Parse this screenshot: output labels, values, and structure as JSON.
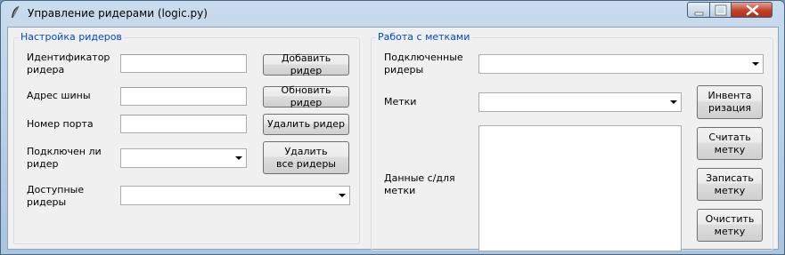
{
  "window": {
    "title": "Управление ридерами (logic.py)",
    "controls": [
      "minimize-icon",
      "maximize-icon",
      "close-icon"
    ]
  },
  "reader_settings": {
    "group_title": "Настройка ридеров",
    "fields": {
      "reader_id_label": "Идентификатор\nридера",
      "reader_id_value": "",
      "bus_address_label": "Адрес шины",
      "bus_address_value": "",
      "port_number_label": "Номер порта",
      "port_number_value": "",
      "connected_label": "Подключен ли\nридер",
      "connected_value": "",
      "available_label": "Доступные\nридеры",
      "available_value": ""
    },
    "buttons": {
      "add": "Добавить ридер",
      "update": "Обновить ридер",
      "delete": "Удалить ридер",
      "delete_all": "Удалить\nвсе ридеры"
    }
  },
  "tag_work": {
    "group_title": "Работа с метками",
    "connected_readers_label": "Подключенные\nридеры",
    "connected_readers_value": "",
    "tags_label": "Метки",
    "tags_value": "",
    "tag_data_label": "Данные с/для\nметки",
    "tag_data_value": "",
    "buttons": {
      "inventory": "Инвента\nризация",
      "read": "Считать\nметку",
      "write": "Записать\nметку",
      "clear": "Очистить\nметку"
    }
  }
}
